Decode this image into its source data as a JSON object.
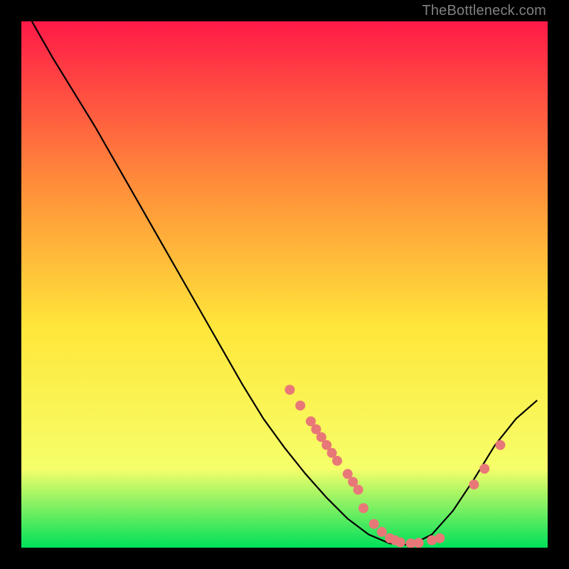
{
  "attribution": "TheBottleneck.com",
  "chart_data": {
    "type": "line",
    "title": "",
    "xlabel": "",
    "ylabel": "",
    "xlim": [
      0,
      100
    ],
    "ylim": [
      0,
      100
    ],
    "grid": false,
    "legend": false,
    "background_gradient": {
      "top": "#ff1a48",
      "mid_upper": "#ff8a3a",
      "mid": "#ffe63a",
      "mid_lower": "#f6ff6a",
      "bottom": "#00e05a"
    },
    "curve": {
      "name": "bottleneck-curve",
      "color": "#000000",
      "points": [
        {
          "x": 2.0,
          "y": 100.0
        },
        {
          "x": 6.0,
          "y": 93.0
        },
        {
          "x": 10.0,
          "y": 86.5
        },
        {
          "x": 14.0,
          "y": 80.0
        },
        {
          "x": 18.0,
          "y": 73.0
        },
        {
          "x": 22.0,
          "y": 66.0
        },
        {
          "x": 26.0,
          "y": 59.0
        },
        {
          "x": 30.0,
          "y": 52.0
        },
        {
          "x": 34.0,
          "y": 45.0
        },
        {
          "x": 38.0,
          "y": 38.0
        },
        {
          "x": 42.0,
          "y": 31.0
        },
        {
          "x": 46.0,
          "y": 24.5
        },
        {
          "x": 50.0,
          "y": 19.0
        },
        {
          "x": 54.0,
          "y": 14.0
        },
        {
          "x": 58.0,
          "y": 9.5
        },
        {
          "x": 62.0,
          "y": 5.5
        },
        {
          "x": 66.0,
          "y": 2.5
        },
        {
          "x": 70.0,
          "y": 0.8
        },
        {
          "x": 74.0,
          "y": 0.5
        },
        {
          "x": 78.0,
          "y": 2.5
        },
        {
          "x": 82.0,
          "y": 7.0
        },
        {
          "x": 86.0,
          "y": 13.0
        },
        {
          "x": 90.0,
          "y": 19.5
        },
        {
          "x": 94.0,
          "y": 24.5
        },
        {
          "x": 98.0,
          "y": 28.0
        }
      ]
    },
    "scatter": {
      "name": "gpu-points",
      "color": "#e87878",
      "radius": 7,
      "points": [
        {
          "x": 51.0,
          "y": 30.0
        },
        {
          "x": 53.0,
          "y": 27.0
        },
        {
          "x": 55.0,
          "y": 24.0
        },
        {
          "x": 56.0,
          "y": 22.5
        },
        {
          "x": 57.0,
          "y": 21.0
        },
        {
          "x": 58.0,
          "y": 19.5
        },
        {
          "x": 59.0,
          "y": 18.0
        },
        {
          "x": 60.0,
          "y": 16.5
        },
        {
          "x": 62.0,
          "y": 14.0
        },
        {
          "x": 63.0,
          "y": 12.5
        },
        {
          "x": 64.0,
          "y": 11.0
        },
        {
          "x": 65.0,
          "y": 7.5
        },
        {
          "x": 67.0,
          "y": 4.5
        },
        {
          "x": 68.5,
          "y": 3.0
        },
        {
          "x": 70.0,
          "y": 1.8
        },
        {
          "x": 71.0,
          "y": 1.4
        },
        {
          "x": 72.0,
          "y": 1.0
        },
        {
          "x": 74.0,
          "y": 0.8
        },
        {
          "x": 75.5,
          "y": 0.9
        },
        {
          "x": 78.0,
          "y": 1.4
        },
        {
          "x": 79.5,
          "y": 1.8
        },
        {
          "x": 86.0,
          "y": 12.0
        },
        {
          "x": 88.0,
          "y": 15.0
        },
        {
          "x": 91.0,
          "y": 19.5
        }
      ]
    }
  }
}
